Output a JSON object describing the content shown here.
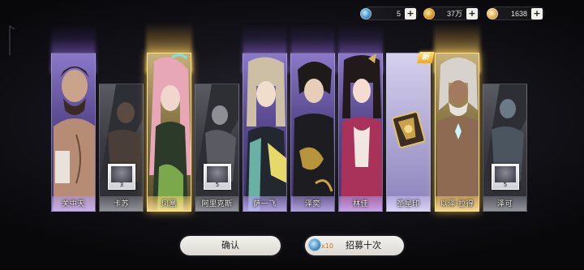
{
  "resources": [
    {
      "icon": "recruit-token-icon",
      "value": "5"
    },
    {
      "icon": "coin-icon",
      "value": "37万"
    },
    {
      "icon": "jade-icon",
      "value": "1638"
    }
  ],
  "colors": {
    "purple_rarity": "#6e5ca8",
    "gold_rarity": "#ffd66e",
    "gray_rarity": "#4a4a52",
    "lilac_rarity": "#9a92c8"
  },
  "cards": [
    {
      "name": "关中天",
      "rarity": "purple",
      "size": "big"
    },
    {
      "name": "卡苏",
      "rarity": "gray",
      "size": "small",
      "fragment_count": "3"
    },
    {
      "name": "凤凰",
      "rarity": "gold",
      "size": "big"
    },
    {
      "name": "阿里克斯",
      "rarity": "gray",
      "size": "small",
      "fragment_count": "5"
    },
    {
      "name": "萨一飞",
      "rarity": "purple",
      "size": "big"
    },
    {
      "name": "泽奕",
      "rarity": "purple",
      "size": "big"
    },
    {
      "name": "林佳",
      "rarity": "purple",
      "size": "big"
    },
    {
      "name": "圣星印",
      "rarity": "lilac",
      "size": "big"
    },
    {
      "name": "以泽·拉得",
      "rarity": "gold",
      "size": "big",
      "badge": "新"
    },
    {
      "name": "泽可",
      "rarity": "gray",
      "size": "small",
      "fragment_count": "5"
    }
  ],
  "buttons": {
    "confirm": "确认",
    "recruit_multiplier": "x10",
    "recruit_ten": "招募十次"
  }
}
